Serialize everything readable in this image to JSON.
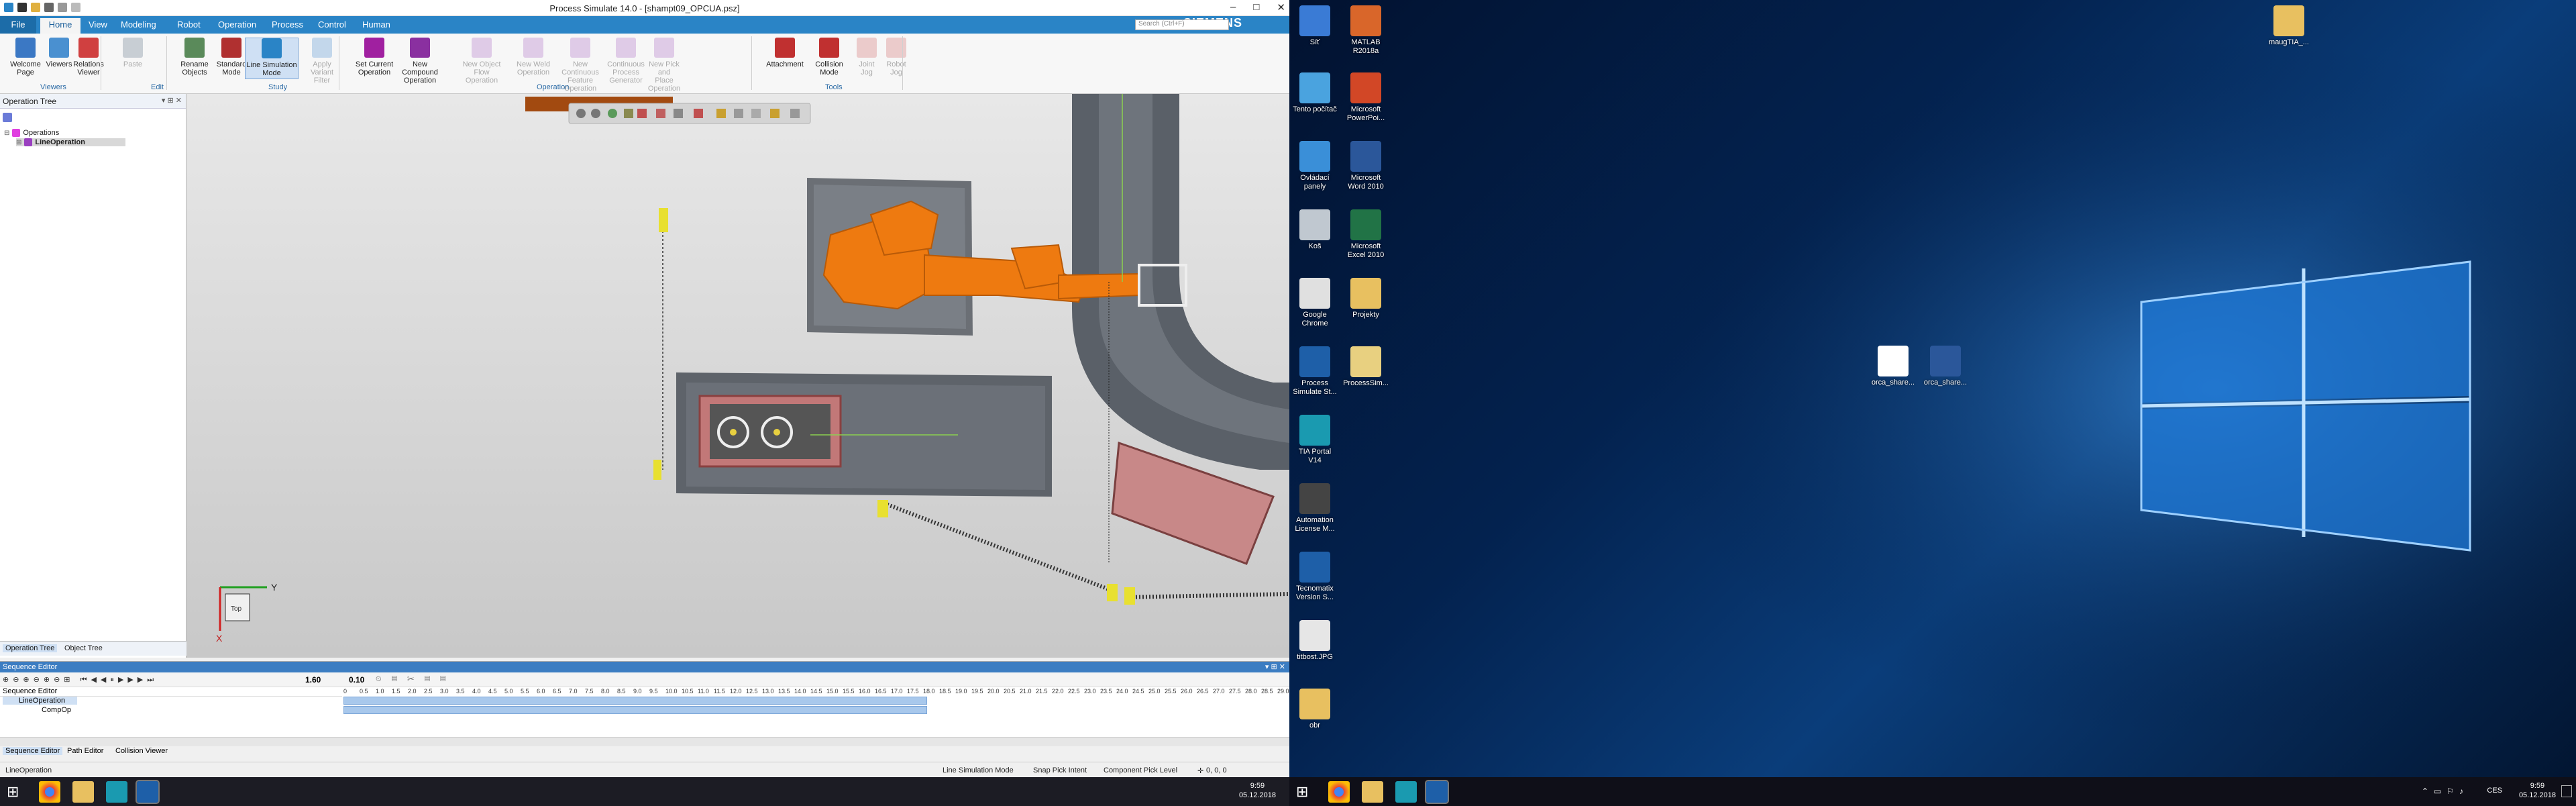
{
  "app": {
    "title": "Process Simulate 14.0 - [shampt09_OPCUA.psz]",
    "brand": "SIEMENS",
    "search_placeholder": "Search (Ctrl+F)",
    "window_controls": [
      "–",
      "□",
      "✕"
    ]
  },
  "ribbon_tabs": [
    "File",
    "Home",
    "View",
    "Modeling",
    "Robot",
    "Operation",
    "Process",
    "Control",
    "Human"
  ],
  "ribbon": {
    "buttons": [
      {
        "label": "Welcome\nPage",
        "group": "Viewers",
        "disabled": false,
        "color": "#3b78c4"
      },
      {
        "label": "Viewers",
        "group": "Viewers",
        "disabled": false,
        "color": "#4a90d0"
      },
      {
        "label": "Relations\nViewer",
        "group": "Viewers",
        "disabled": false,
        "color": "#d04040"
      },
      {
        "label": "Paste",
        "group": "Edit",
        "disabled": true,
        "color": "#9aa6b2"
      },
      {
        "label": "Rename\nObjects",
        "group": "Edit",
        "disabled": false,
        "color": "#5a8a5a"
      },
      {
        "label": "Standard\nMode",
        "group": "Study",
        "disabled": false,
        "color": "#b03030"
      },
      {
        "label": "Line Simulation\nMode",
        "group": "Study",
        "disabled": false,
        "color": "#2a84c6"
      },
      {
        "label": "Apply\nVariant Filter",
        "group": "Study",
        "disabled": true,
        "color": "#8fb8e0"
      },
      {
        "label": "Set Current\nOperation",
        "group": "Operation",
        "disabled": false,
        "color": "#a020a0"
      },
      {
        "label": "New Compound\nOperation",
        "group": "Operation",
        "disabled": false,
        "color": "#8a30a0"
      },
      {
        "label": "New Object\nFlow Operation",
        "group": "Operation",
        "disabled": true,
        "color": "#c8a0d8"
      },
      {
        "label": "New Weld\nOperation",
        "group": "Operation",
        "disabled": true,
        "color": "#c8a0d8"
      },
      {
        "label": "New Continuous\nFeature Operation",
        "group": "Operation",
        "disabled": true,
        "color": "#c8a0d8"
      },
      {
        "label": "Continuous\nProcess Generator",
        "group": "Operation",
        "disabled": true,
        "color": "#c8a0d8"
      },
      {
        "label": "New Pick and\nPlace Operation",
        "group": "Operation",
        "disabled": true,
        "color": "#c8a0d8"
      },
      {
        "label": "Attachment",
        "group": "Tools",
        "disabled": false,
        "color": "#c03030"
      },
      {
        "label": "Collision\nMode",
        "group": "Tools",
        "disabled": false,
        "color": "#c03030"
      },
      {
        "label": "Joint\nJog",
        "group": "Tools",
        "disabled": true,
        "color": "#e0a0a0"
      },
      {
        "label": "Robot\nJog",
        "group": "Tools",
        "disabled": true,
        "color": "#e0a0a0"
      }
    ],
    "groups": [
      "Viewers",
      "Edit",
      "Study",
      "Operation",
      "Tools"
    ]
  },
  "operation_tree": {
    "title": "Operation Tree",
    "items": [
      {
        "label": "Operations",
        "level": 0
      },
      {
        "label": "LineOperation",
        "level": 1,
        "selected": true
      }
    ]
  },
  "left_bottom_tabs": [
    "Operation Tree",
    "Object Tree"
  ],
  "viewport": {
    "axis_labels": {
      "y": "Y",
      "x": "X",
      "cube": "Top"
    }
  },
  "sequence_editor": {
    "title": "Sequence Editor",
    "time_current": "1.60",
    "time_step": "0.10",
    "column_header": "Sequence Editor",
    "rows": [
      {
        "label": "LineOperation",
        "level": 0
      },
      {
        "label": "CompOp",
        "level": 1
      }
    ],
    "ruler_ticks": [
      "0",
      "0.5",
      "1.0",
      "1.5",
      "2.0",
      "2.5",
      "3.0",
      "3.5",
      "4.0",
      "4.5",
      "5.0",
      "5.5",
      "6.0",
      "6.5",
      "7.0",
      "7.5",
      "8.0",
      "8.5",
      "9.0",
      "9.5",
      "10.0",
      "10.5",
      "11.0",
      "11.5",
      "12.0",
      "12.5",
      "13.0",
      "13.5",
      "14.0",
      "14.5",
      "15.0",
      "15.5",
      "16.0",
      "16.5",
      "17.0",
      "17.5",
      "18.0",
      "18.5",
      "19.0",
      "19.5",
      "20.0",
      "20.5",
      "21.0",
      "21.5",
      "22.0",
      "22.5",
      "23.0",
      "23.5",
      "24.0",
      "24.5",
      "25.0",
      "25.5",
      "26.0",
      "26.5",
      "27.0",
      "27.5",
      "28.0",
      "28.5",
      "29.0"
    ],
    "tabs": [
      "Sequence Editor",
      "Path Editor",
      "Collision Viewer"
    ]
  },
  "statusbar": {
    "left": "LineOperation",
    "mode": "Line Simulation Mode",
    "snap": "Snap Pick Intent",
    "pick": "Component Pick Level",
    "coords": "0, 0, 0"
  },
  "taskbar_left": {
    "time": "9:59",
    "date": "05.12.2018"
  },
  "desktop_icons": [
    {
      "label": "Síť",
      "color": "#3a7bd5"
    },
    {
      "label": "MATLAB\nR2018a",
      "color": "#d9662a"
    },
    {
      "label": "Tento počítač",
      "color": "#4aa3df"
    },
    {
      "label": "Microsoft\nPowerPoi...",
      "color": "#d24726"
    },
    {
      "label": "Ovládací\npanely",
      "color": "#3a8fd8"
    },
    {
      "label": "Microsoft\nWord 2010",
      "color": "#2b579a"
    },
    {
      "label": "Koš",
      "color": "#c0c8d0"
    },
    {
      "label": "Microsoft\nExcel 2010",
      "color": "#217346"
    },
    {
      "label": "Google\nChrome",
      "color": "#e0e0e0"
    },
    {
      "label": "Projekty",
      "color": "#e8c060"
    },
    {
      "label": "Process\nSimulate St...",
      "color": "#1e5fa8"
    },
    {
      "label": "ProcessSim...",
      "color": "#e8d080"
    },
    {
      "label": "TIA Portal\nV14",
      "color": "#1a9ab0"
    },
    {
      "label": "Automation\nLicense M...",
      "color": "#444"
    },
    {
      "label": "Tecnomatix\nVersion S...",
      "color": "#1e5fa8"
    },
    {
      "label": "titbost.JPG",
      "color": "#e6e6e6"
    },
    {
      "label": "obr",
      "color": "#e8c060"
    },
    {
      "label": "maugTIA_...",
      "color": "#e8c060"
    },
    {
      "label": "orca_share...",
      "color": "#ffffff"
    },
    {
      "label": "orca_share...",
      "color": "#2b579a"
    }
  ],
  "taskbar_right": {
    "time": "9:59",
    "date": "05.12.2018",
    "lang": "CES"
  }
}
